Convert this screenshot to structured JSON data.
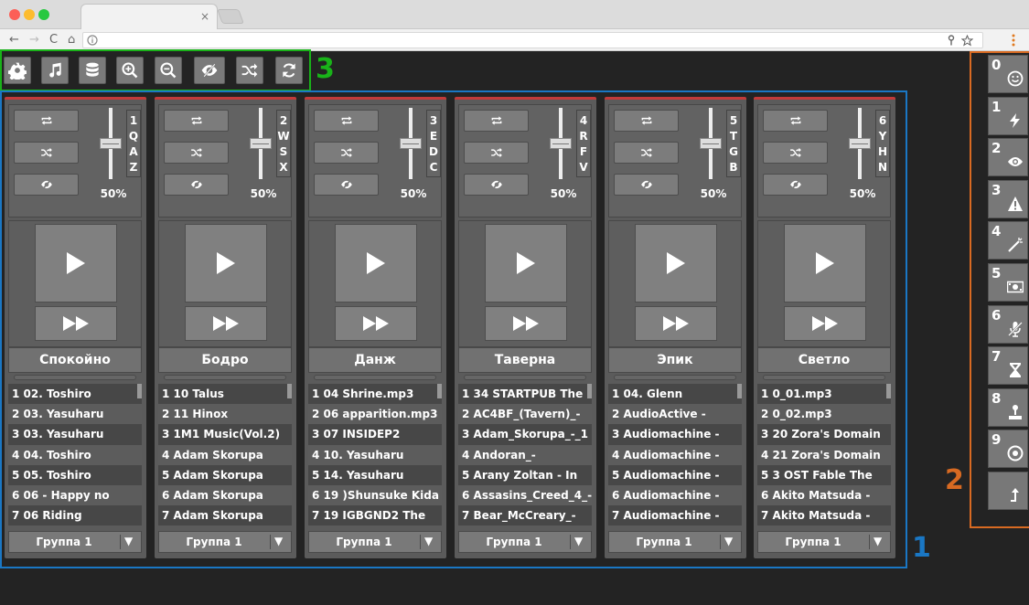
{
  "browser": {
    "tab_close": "×",
    "nav": {
      "back": "←",
      "forward": "→",
      "reload": "C",
      "home": "⌂"
    }
  },
  "toolbar": {
    "buttons": [
      {
        "name": "settings",
        "icon": "gear-icon"
      },
      {
        "name": "music",
        "icon": "music-note-icon"
      },
      {
        "name": "database",
        "icon": "database-icon"
      },
      {
        "name": "zoom-in",
        "icon": "zoom-in-icon"
      },
      {
        "name": "zoom-out",
        "icon": "zoom-out-icon"
      },
      {
        "name": "hide",
        "icon": "eye-slash-icon"
      },
      {
        "name": "shuffle",
        "icon": "shuffle-icon"
      },
      {
        "name": "refresh",
        "icon": "refresh-icon"
      }
    ]
  },
  "annotations": {
    "toolbar": "3",
    "side_panel": "2",
    "mixer": "1"
  },
  "colors": {
    "toolbar_frame": "#19b219",
    "side_frame": "#d86a22",
    "mixer_frame": "#1a77c4",
    "deck_accent": "#c23a3a"
  },
  "decks": [
    {
      "index": "1",
      "keys": [
        "1",
        "Q",
        "A",
        "Z"
      ],
      "volume": "50%",
      "volume_level": 0.5,
      "name": "Спокойно",
      "group": "Группа 1",
      "tracks": [
        "1 02. Toshiro",
        "2 03. Yasuharu",
        "3 03. Yasuharu",
        "4 04. Toshiro",
        "5 05. Toshiro",
        "6 06 - Happy no",
        "7 06 Riding"
      ]
    },
    {
      "index": "2",
      "keys": [
        "2",
        "W",
        "S",
        "X"
      ],
      "volume": "50%",
      "volume_level": 0.5,
      "name": "Бодро",
      "group": "Группа 1",
      "tracks": [
        "1 10 Talus",
        "2 11 Hinox",
        "3 1M1 Music(Vol.2)",
        "4 Adam Skorupa",
        "5 Adam Skorupa",
        "6 Adam Skorupa",
        "7 Adam Skorupa"
      ]
    },
    {
      "index": "3",
      "keys": [
        "3",
        "E",
        "D",
        "C"
      ],
      "volume": "50%",
      "volume_level": 0.5,
      "name": "Данж",
      "group": "Группа 1",
      "tracks": [
        "1 04 Shrine.mp3",
        "2 06 apparition.mp3",
        "3 07 INSIDEP2",
        "4 10. Yasuharu",
        "5 14. Yasuharu",
        "6 19 )Shunsuke Kida",
        "7 19 IGBGND2 The"
      ]
    },
    {
      "index": "4",
      "keys": [
        "4",
        "R",
        "F",
        "V"
      ],
      "volume": "50%",
      "volume_level": 0.5,
      "name": "Таверна",
      "group": "Группа 1",
      "tracks": [
        "1 34 STARTPUB The",
        "2 AC4BF_(Tavern)_-",
        "3 Adam_Skorupa_-_1",
        "4 Andoran_-",
        "5 Arany Zoltan - In",
        "6 Assasins_Creed_4_-",
        "7 Bear_McCreary_-"
      ]
    },
    {
      "index": "5",
      "keys": [
        "5",
        "T",
        "G",
        "B"
      ],
      "volume": "50%",
      "volume_level": 0.5,
      "name": "Эпик",
      "group": "Группа 1",
      "tracks": [
        "1 04. Glenn",
        "2 AudioActive -",
        "3 Audiomachine -",
        "4 Audiomachine -",
        "5 Audiomachine -",
        "6 Audiomachine -",
        "7 Audiomachine -"
      ]
    },
    {
      "index": "6",
      "keys": [
        "6",
        "Y",
        "H",
        "N"
      ],
      "volume": "50%",
      "volume_level": 0.5,
      "name": "Светло",
      "group": "Группа 1",
      "tracks": [
        "1 0_01.mp3",
        "2 0_02.mp3",
        "3 20 Zora's Domain",
        "4 21 Zora's Domain",
        "5 3 OST Fable The",
        "6 Akito Matsuda -",
        "7 Akito Matsuda -"
      ]
    }
  ],
  "side_panel": {
    "buttons": [
      {
        "num": "0",
        "icon": "smiley-icon"
      },
      {
        "num": "1",
        "icon": "lightning-icon"
      },
      {
        "num": "2",
        "icon": "eye-icon"
      },
      {
        "num": "3",
        "icon": "warning-icon"
      },
      {
        "num": "4",
        "icon": "magic-wand-icon"
      },
      {
        "num": "5",
        "icon": "money-icon"
      },
      {
        "num": "6",
        "icon": "microphone-slash-icon"
      },
      {
        "num": "7",
        "icon": "hourglass-icon"
      },
      {
        "num": "8",
        "icon": "joystick-icon"
      },
      {
        "num": "9",
        "icon": "target-icon"
      },
      {
        "num": "",
        "icon": "level-up-icon"
      }
    ]
  }
}
